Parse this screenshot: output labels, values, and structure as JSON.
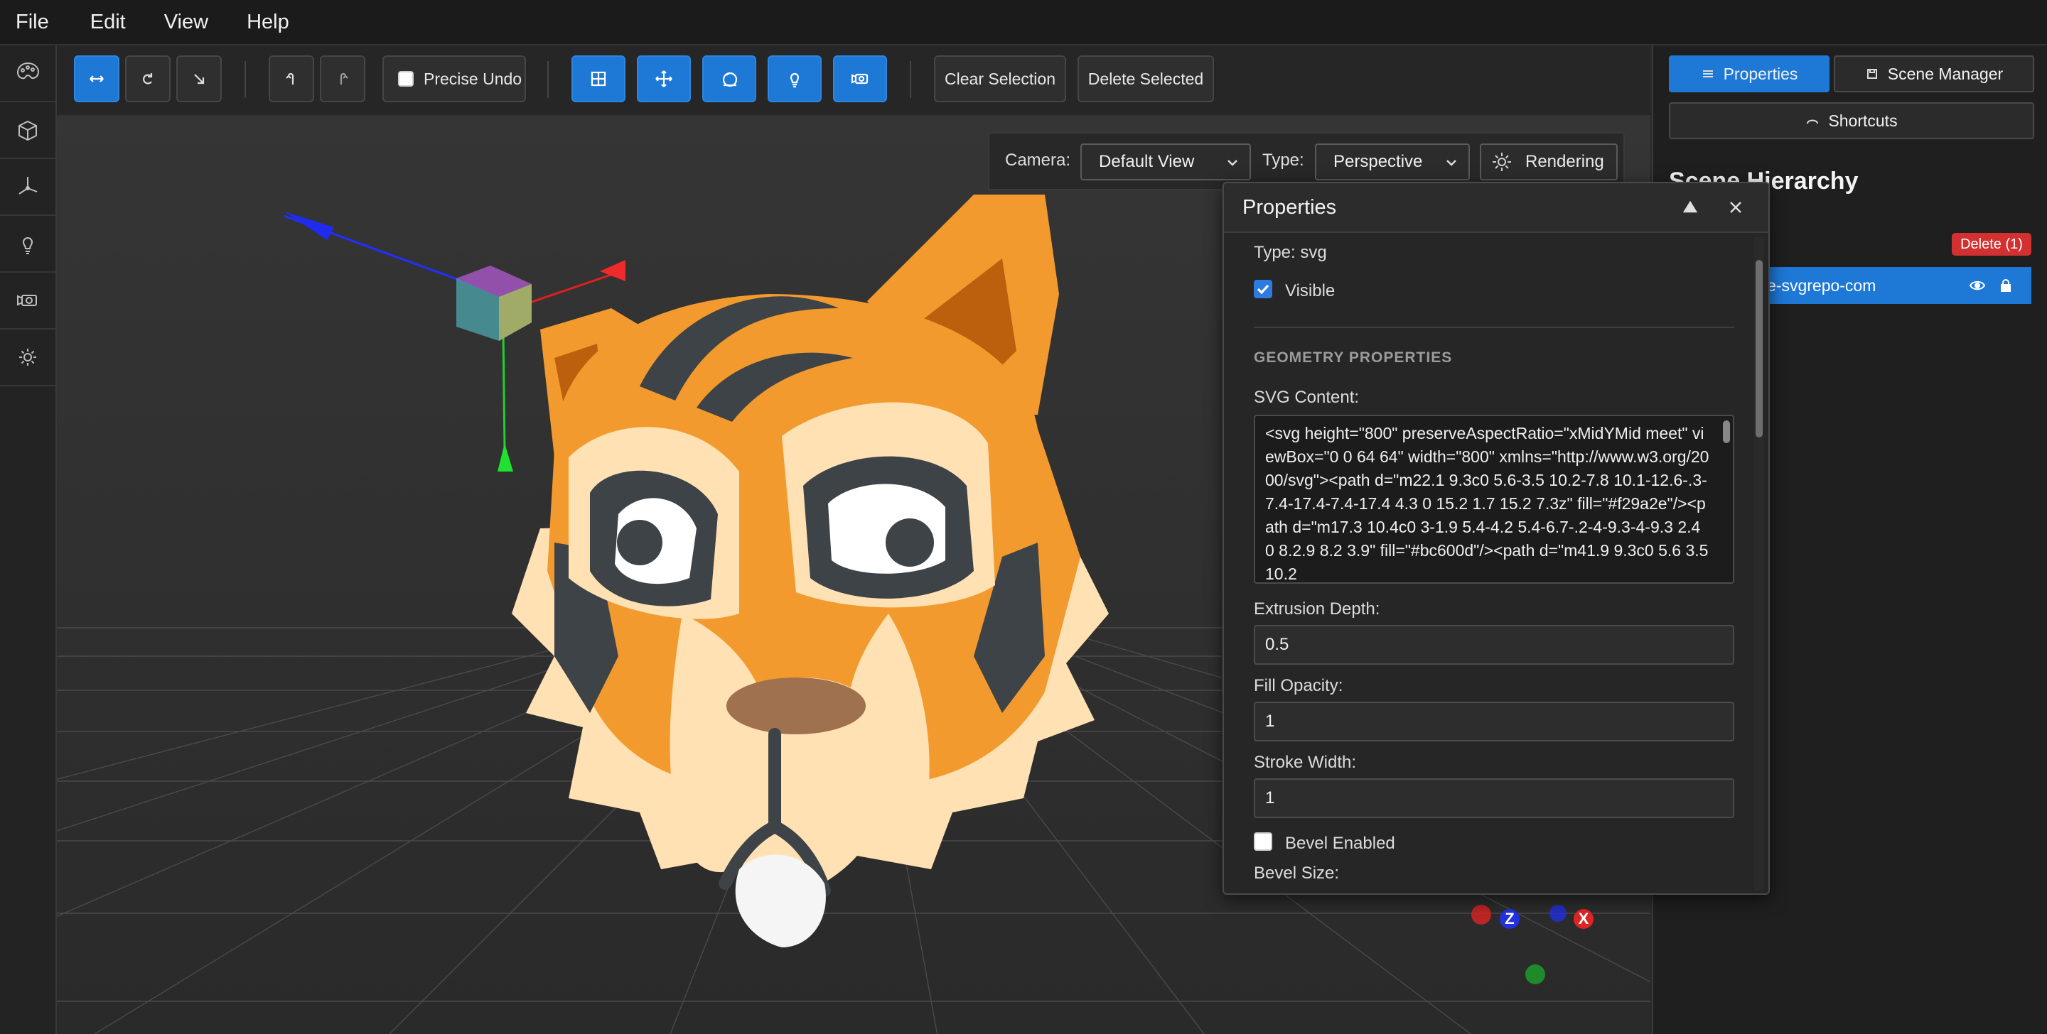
{
  "menu": {
    "file": "File",
    "edit": "Edit",
    "view": "View",
    "help": "Help"
  },
  "left_rail": {
    "icons": [
      "palette-icon",
      "cube-icon",
      "axis-icon",
      "lightbulb-icon",
      "camera-icon",
      "gear-icon"
    ]
  },
  "toolbar": {
    "transform_icons": [
      "move-icon",
      "rotate-icon",
      "scale-icon"
    ],
    "undo_icon": "undo-icon",
    "redo_icon": "redo-icon",
    "precise_undo_label": "Precise Undo",
    "precise_undo_checked": false,
    "tool_icons": [
      "grid-icon",
      "axes-move-icon",
      "sphere-icon",
      "light-icon",
      "camera-icon"
    ],
    "clear_selection_label": "Clear Selection",
    "delete_selected_label": "Delete Selected"
  },
  "camera_bar": {
    "camera_label": "Camera:",
    "camera_value": "Default View",
    "type_label": "Type:",
    "type_value": "Perspective",
    "rendering_label": "Rendering"
  },
  "right_panel": {
    "tabs": {
      "properties": "Properties",
      "scene_manager": "Scene Manager",
      "shortcuts": "Shortcuts"
    },
    "hierarchy_title": "Scene Hierarchy",
    "delete_badge": "Delete (1)",
    "selected_item": "e-svgrepo-com"
  },
  "properties_window": {
    "title": "Properties",
    "type_line": "Type: svg",
    "visible_label": "Visible",
    "visible_checked": true,
    "geometry_header": "GEOMETRY PROPERTIES",
    "svg_content_label": "SVG Content:",
    "svg_content": "<svg height=\"800\" preserveAspectRatio=\"xMidYMid meet\" viewBox=\"0 0 64 64\" width=\"800\" xmlns=\"http://www.w3.org/2000/svg\"><path d=\"m22.1 9.3c0 5.6-3.5 10.2-7.8 10.1-12.6-.3-7.4-17.4-7.4-17.4 4.3 0 15.2 1.7 15.2 7.3z\" fill=\"#f29a2e\"/><path d=\"m17.3 10.4c0 3-1.9 5.4-4.2 5.4-6.7-.2-4-9.3-4-9.3 2.4 0 8.2.9 8.2 3.9\" fill=\"#bc600d\"/><path d=\"m41.9 9.3c0 5.6 3.5 10.2",
    "extrusion_label": "Extrusion Depth:",
    "extrusion_value": "0.5",
    "fill_opacity_label": "Fill Opacity:",
    "fill_opacity_value": "1",
    "stroke_width_label": "Stroke Width:",
    "stroke_width_value": "1",
    "bevel_enabled_label": "Bevel Enabled",
    "bevel_enabled_checked": false,
    "bevel_size_label": "Bevel Size:"
  },
  "gizmo": {
    "z": "Z",
    "x": "X"
  },
  "colors": {
    "accent": "#1d78d6",
    "danger": "#d33131",
    "tiger_orange": "#f29a2e",
    "tiger_dark": "#3e4347",
    "tiger_cream": "#ffe1b3",
    "tiger_brown": "#bc600d"
  }
}
